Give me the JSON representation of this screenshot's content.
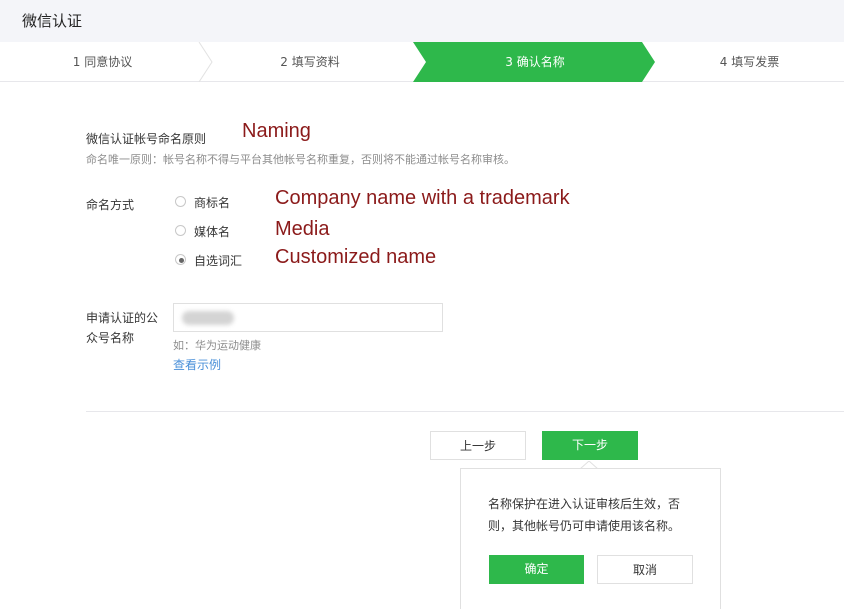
{
  "header": {
    "title": "微信认证"
  },
  "steps": [
    {
      "label": "1 同意协议"
    },
    {
      "label": "2 填写资料"
    },
    {
      "label": "3 确认名称"
    },
    {
      "label": "4 填写发票"
    }
  ],
  "colors": {
    "accent": "#2eb84b",
    "link": "#4a90d9",
    "annotation": "#8b1a1a"
  },
  "naming_section": {
    "title": "微信认证帐号命名原则",
    "description": "命名唯一原则：帐号名称不得与平台其他帐号名称重复，否则将不能通过帐号名称审核。"
  },
  "naming_method": {
    "label": "命名方式",
    "options": [
      {
        "label": "商标名",
        "checked": false
      },
      {
        "label": "媒体名",
        "checked": false
      },
      {
        "label": "自选词汇",
        "checked": true
      }
    ]
  },
  "annotations": {
    "naming": "Naming",
    "trademark": "Company name with a trademark",
    "media": "Media",
    "customized": "Customized name"
  },
  "apply_name": {
    "label_line1": "申请认证的公",
    "label_line2": "众号名称",
    "example": "如：华为运动健康",
    "example_link": "查看示例"
  },
  "buttons": {
    "prev": "上一步",
    "next": "下一步"
  },
  "popover": {
    "text": "名称保护在进入认证审核后生效，否则，其他帐号仍可申请使用该名称。",
    "ok": "确定",
    "cancel": "取消"
  }
}
